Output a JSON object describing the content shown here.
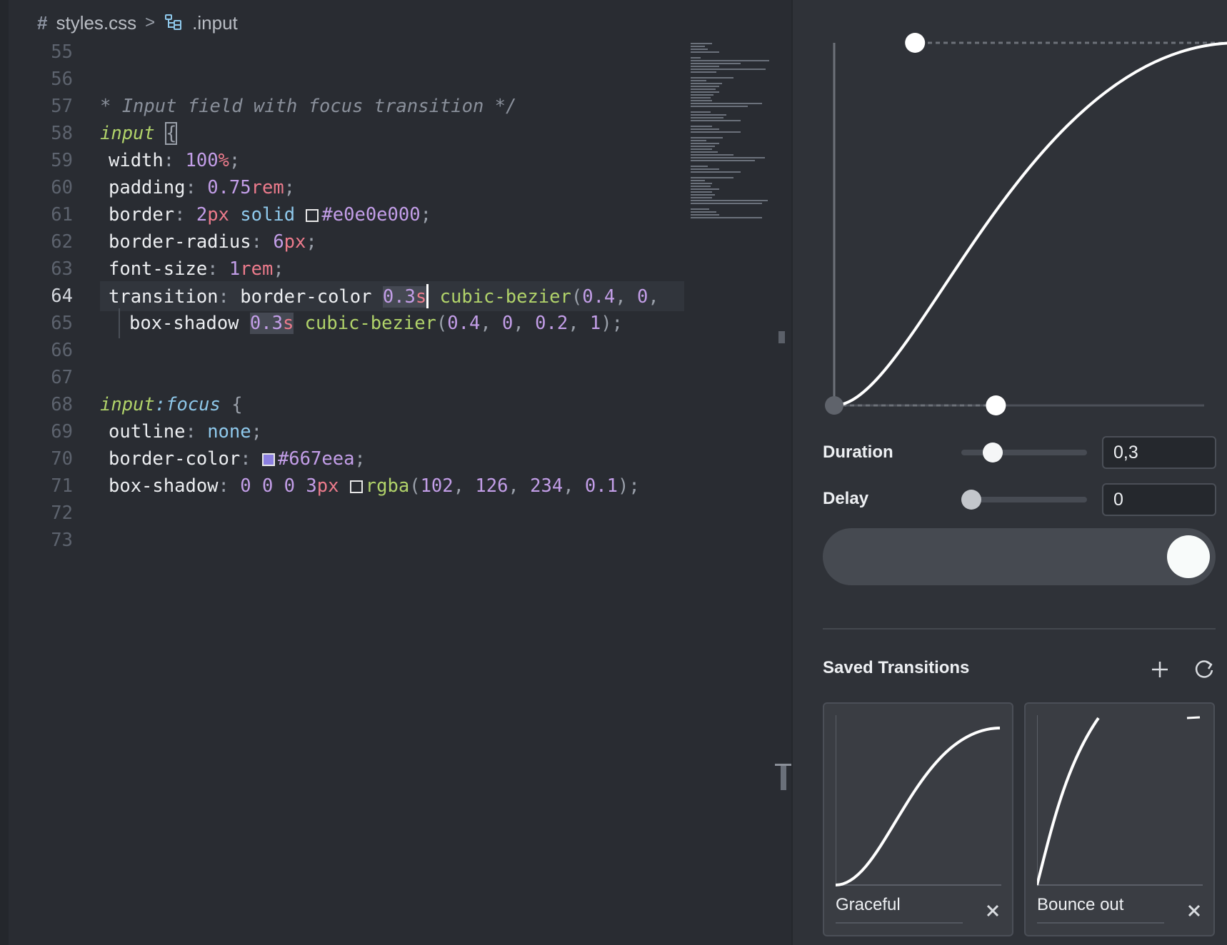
{
  "breadcrumb": {
    "file_icon": "#",
    "file": "styles.css",
    "separator": ">",
    "symbol_icon": "selector-icon",
    "symbol": ".input"
  },
  "editor": {
    "active_line": 64,
    "lines": [
      {
        "n": "55",
        "text": ""
      },
      {
        "n": "56",
        "text": ""
      },
      {
        "n": "57",
        "text": "* Input field with focus transition */"
      },
      {
        "n": "58",
        "text": "input {"
      },
      {
        "n": "59",
        "text": "width: 100%;"
      },
      {
        "n": "60",
        "text": "padding: 0.75rem;"
      },
      {
        "n": "61",
        "text": "border: 2px solid #e0e0e000;"
      },
      {
        "n": "62",
        "text": "border-radius: 6px;"
      },
      {
        "n": "63",
        "text": "font-size: 1rem;"
      },
      {
        "n": "64",
        "text": "transition: border-color 0.3s cubic-bezier(0.4, 0,"
      },
      {
        "n": "65",
        "text": "box-shadow 0.3s cubic-bezier(0.4, 0, 0.2, 1);"
      },
      {
        "n": "66",
        "text": ""
      },
      {
        "n": "67",
        "text": ""
      },
      {
        "n": "68",
        "text": "input:focus {"
      },
      {
        "n": "69",
        "text": "outline: none;"
      },
      {
        "n": "70",
        "text": "border-color: #667eea;"
      },
      {
        "n": "71",
        "text": "box-shadow: 0 0 0 3px rgba(102, 126, 234, 0.1);"
      },
      {
        "n": "72",
        "text": ""
      },
      {
        "n": "73",
        "text": ""
      }
    ],
    "swatch_colors": {
      "border": "#e0e0e0",
      "focus": "#667eea",
      "shadow": "#ffffff"
    }
  },
  "curve": {
    "control_points": [
      0.4,
      0,
      0.2,
      1
    ],
    "colors": {
      "curve": "#ffffff",
      "handle": "#ffffff",
      "endpoint": "#5f636b",
      "guide": "#6d7179"
    }
  },
  "controls": {
    "duration": {
      "label": "Duration",
      "value": "0,3",
      "slider_fraction": 0.2
    },
    "delay": {
      "label": "Delay",
      "value": "0",
      "slider_fraction": 0.0
    }
  },
  "preview": {
    "progress": 1.0
  },
  "saved": {
    "title": "Saved Transitions",
    "add_icon": "plus-icon",
    "reset_icon": "refresh-icon",
    "items": [
      {
        "name": "Graceful",
        "close_icon": "close-icon"
      },
      {
        "name": "Bounce out",
        "close_icon": "close-icon"
      }
    ]
  }
}
